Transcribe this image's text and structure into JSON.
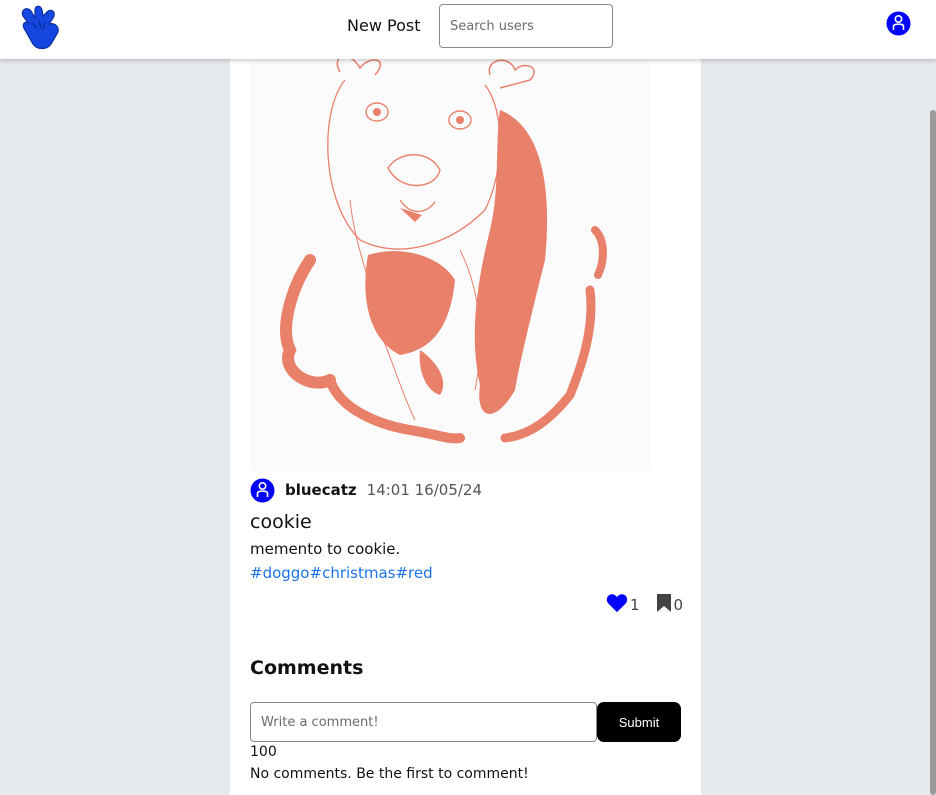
{
  "navbar": {
    "logo_icon": "hand-sign-logo-icon",
    "new_post_label": "New Post",
    "search_placeholder": "Search users",
    "avatar_icon": "user-avatar-icon"
  },
  "post": {
    "image_icon": "dog-illustration-image",
    "author": "bluecatz",
    "timestamp": "14:01 16/05/24",
    "title": "cookie",
    "description": "memento to cookie.",
    "tags": [
      "#doggo",
      "#christmas",
      "#red"
    ],
    "likes": "1",
    "bookmarks": "0"
  },
  "comments": {
    "heading": "Comments",
    "input_placeholder": "Write a comment!",
    "submit_label": "Submit",
    "char_count": "100",
    "empty_message": "No comments. Be the first to comment!"
  },
  "colors": {
    "accent_blue": "#0000ff",
    "link_blue": "#1a73e8",
    "logo_blue": "#1547e0",
    "illustration_salmon": "#e8806a",
    "background": "#e6e9ed"
  }
}
